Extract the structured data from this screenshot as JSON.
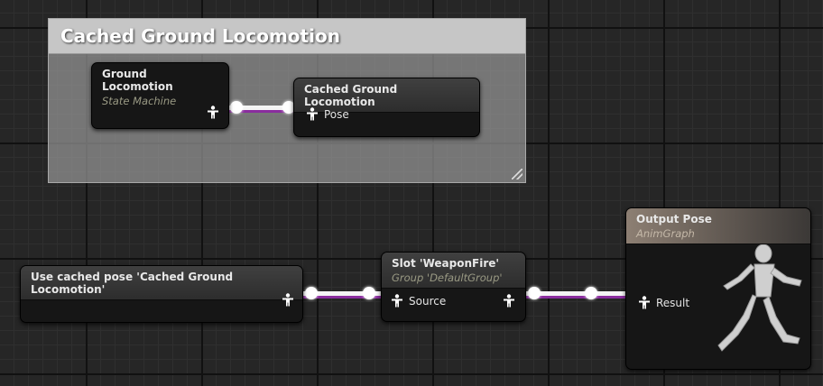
{
  "comment": {
    "title": "Cached Ground Locomotion"
  },
  "nodes": {
    "ground_locomotion": {
      "title": "Ground Locomotion",
      "subtitle": "State Machine"
    },
    "cached_ground_locomotion": {
      "title": "Cached Ground Locomotion",
      "pin": "Pose"
    },
    "use_cached_pose": {
      "title": "Use cached pose 'Cached Ground Locomotion'"
    },
    "slot": {
      "title": "Slot 'WeaponFire'",
      "subtitle": "Group 'DefaultGroup'",
      "pin": "Source"
    },
    "output_pose": {
      "title": "Output Pose",
      "subtitle": "AnimGraph",
      "pin": "Result"
    }
  },
  "colors": {
    "wire": "#f4f4f4",
    "wire_shadow": "#8a2d9e",
    "grid_bg": "#262626"
  },
  "icons": {
    "pose_pin": "pose-person-icon",
    "preview": "mannequin-running-icon"
  }
}
